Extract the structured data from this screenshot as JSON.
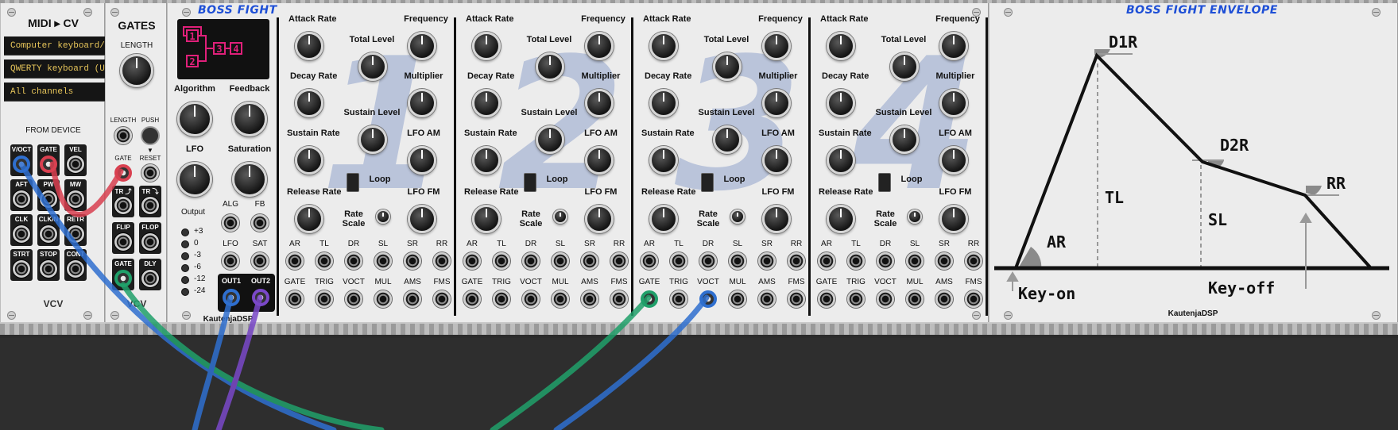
{
  "midi": {
    "title": "MIDI ▸ CV",
    "device_lines": [
      "Computer keyboard/mouse",
      "QWERTY keyboard (US)",
      "All channels"
    ],
    "from_device": "FROM DEVICE",
    "jacks": [
      "V/OCT",
      "GATE",
      "VEL",
      "AFT",
      "PW",
      "MW",
      "CLK",
      "CLK/N",
      "RETR",
      "STRT",
      "STOP",
      "CONT"
    ],
    "brand": "VCV"
  },
  "gates": {
    "title": "GATES",
    "length": "LENGTH",
    "length_small": "LENGTH",
    "push": "PUSH",
    "gate": "GATE",
    "reset": "RESET",
    "jacks": [
      "TR ⤴",
      "TR ⤵",
      "FLIP",
      "FLOP",
      "GATE",
      "DLY"
    ],
    "brand": "VCV"
  },
  "bossfight": {
    "title": "BOSS FIGHT",
    "algorithm": "Algorithm",
    "feedback": "Feedback",
    "lfo": "LFO",
    "saturation": "Saturation",
    "output": "Output",
    "levels": [
      "+3",
      "0",
      "-3",
      "-6",
      "-12",
      "-24"
    ],
    "cv": [
      "ALG",
      "FB",
      "LFO",
      "SAT"
    ],
    "outs": [
      "OUT1",
      "OUT2"
    ],
    "brand": "KautenjaDSP",
    "algo_ops": [
      "1",
      "2",
      "3",
      "4"
    ],
    "ops": [
      {
        "num": "1"
      },
      {
        "num": "2"
      },
      {
        "num": "3"
      },
      {
        "num": "4"
      }
    ],
    "op_labels": {
      "attack_rate": "Attack Rate",
      "frequency": "Frequency",
      "total_level": "Total Level",
      "decay_rate": "Decay Rate",
      "multiplier": "Multiplier",
      "sustain_level": "Sustain Level",
      "sustain_rate": "Sustain Rate",
      "lfo_am": "LFO AM",
      "loop": "Loop",
      "release_rate": "Release Rate",
      "lfo_fm": "LFO FM",
      "rate_scale_1": "Rate",
      "rate_scale_2": "Scale",
      "row1": [
        "AR",
        "TL",
        "DR",
        "SL",
        "SR",
        "RR"
      ],
      "row2": [
        "GATE",
        "TRIG",
        "VOCT",
        "MUL",
        "AMS",
        "FMS"
      ]
    }
  },
  "envelope": {
    "title": "BOSS FIGHT ENVELOPE",
    "labels": {
      "d1r": "D1R",
      "d2r": "D2R",
      "rr": "RR",
      "tl": "TL",
      "sl": "SL",
      "ar": "AR",
      "key_on": "Key-on",
      "key_off": "Key-off"
    },
    "brand": "KautenjaDSP"
  },
  "cables": {
    "blue": "#2f6fcf",
    "red": "#d94050",
    "green": "#20a06a",
    "purple": "#7a48c8"
  }
}
